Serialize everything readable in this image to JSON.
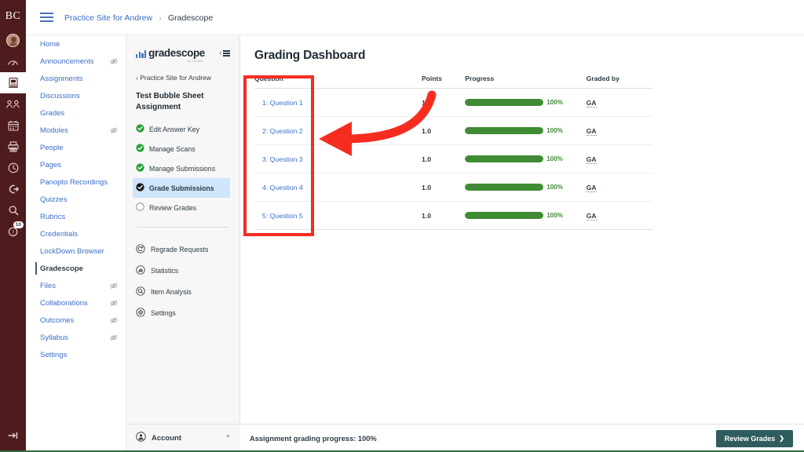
{
  "global_nav": {
    "logo_text": "BC",
    "items": [
      {
        "name": "account-avatar",
        "icon": "avatar-icon",
        "active": false
      },
      {
        "name": "dashboard",
        "icon": "dashboard-speedometer-icon",
        "active": false
      },
      {
        "name": "courses",
        "icon": "courses-book-icon",
        "active": true
      },
      {
        "name": "groups",
        "icon": "groups-people-icon",
        "active": false
      },
      {
        "name": "calendar",
        "icon": "calendar-icon",
        "active": false
      },
      {
        "name": "inbox",
        "icon": "inbox-printer-icon",
        "active": false
      },
      {
        "name": "history",
        "icon": "clock-history-icon",
        "active": false
      },
      {
        "name": "commons",
        "icon": "logout-arrow-icon",
        "active": false
      },
      {
        "name": "studio",
        "icon": "search-magnifier-icon",
        "active": false
      },
      {
        "name": "help",
        "icon": "help-question-icon",
        "active": false,
        "badge": "10"
      }
    ],
    "bottom_item": {
      "name": "expand-nav",
      "icon": "arrow-to-bar-icon"
    }
  },
  "header": {
    "menu_icon": "hamburger-menu-icon",
    "breadcrumb_course": "Practice Site for Andrew",
    "breadcrumb_separator": "›",
    "breadcrumb_current": "Gradescope"
  },
  "course_nav": {
    "items": [
      {
        "label": "Home",
        "hidden": false,
        "active": false
      },
      {
        "label": "Announcements",
        "hidden": true,
        "active": false
      },
      {
        "label": "Assignments",
        "hidden": false,
        "active": false
      },
      {
        "label": "Discussions",
        "hidden": false,
        "active": false
      },
      {
        "label": "Grades",
        "hidden": false,
        "active": false
      },
      {
        "label": "Modules",
        "hidden": true,
        "active": false
      },
      {
        "label": "People",
        "hidden": false,
        "active": false
      },
      {
        "label": "Pages",
        "hidden": false,
        "active": false
      },
      {
        "label": "Panopto Recordings",
        "hidden": false,
        "active": false
      },
      {
        "label": "Quizzes",
        "hidden": false,
        "active": false
      },
      {
        "label": "Rubrics",
        "hidden": false,
        "active": false
      },
      {
        "label": "Credentials",
        "hidden": false,
        "active": false
      },
      {
        "label": "LockDown Browser",
        "hidden": false,
        "active": false
      },
      {
        "label": "Gradescope",
        "hidden": false,
        "active": true
      },
      {
        "label": "Files",
        "hidden": true,
        "active": false
      },
      {
        "label": "Collaborations",
        "hidden": true,
        "active": false
      },
      {
        "label": "Outcomes",
        "hidden": true,
        "active": false
      },
      {
        "label": "Syllabus",
        "hidden": true,
        "active": false
      },
      {
        "label": "Settings",
        "hidden": false,
        "active": false
      }
    ]
  },
  "gradescope_panel": {
    "logo_wordmark": "gradescope",
    "logo_registered": "®",
    "logo_byline": "by Turnitin",
    "collapse_label": "collapse-sidebar",
    "back_link": "‹ Practice Site for Andrew",
    "assignment_title": "Test Bubble Sheet Assignment",
    "steps": [
      {
        "label": "Edit Answer Key",
        "state": "complete"
      },
      {
        "label": "Manage Scans",
        "state": "complete"
      },
      {
        "label": "Manage Submissions",
        "state": "complete"
      },
      {
        "label": "Grade Submissions",
        "state": "current"
      },
      {
        "label": "Review Grades",
        "state": "incomplete"
      }
    ],
    "tools": [
      {
        "label": "Regrade Requests",
        "icon": "regrade-refresh-icon"
      },
      {
        "label": "Statistics",
        "icon": "statistics-chart-icon"
      },
      {
        "label": "Item Analysis",
        "icon": "item-analysis-magnifier-icon"
      },
      {
        "label": "Settings",
        "icon": "settings-gear-icon"
      }
    ],
    "account_label": "Account",
    "account_icon": "account-person-icon",
    "account_chevron": "⌃"
  },
  "main": {
    "page_title": "Grading Dashboard",
    "table": {
      "columns": [
        "Question",
        "Points",
        "Progress",
        "Graded by"
      ],
      "rows": [
        {
          "question": "1: Question 1",
          "points": "1.0",
          "progress_pct": 100,
          "progress_label": "100%",
          "graded_by": "GA"
        },
        {
          "question": "2: Question 2",
          "points": "1.0",
          "progress_pct": 100,
          "progress_label": "100%",
          "graded_by": "GA"
        },
        {
          "question": "3: Question 3",
          "points": "1.0",
          "progress_pct": 100,
          "progress_label": "100%",
          "graded_by": "GA"
        },
        {
          "question": "4: Question 4",
          "points": "1.0",
          "progress_pct": 100,
          "progress_label": "100%",
          "graded_by": "GA"
        },
        {
          "question": "5: Question 5",
          "points": "1.0",
          "progress_pct": 100,
          "progress_label": "100%",
          "graded_by": "GA"
        }
      ]
    },
    "footer_text": "Assignment grading progress: 100%",
    "review_button_label": "Review Grades",
    "review_button_arrow": "❯"
  },
  "annotations": {
    "highlight_color": "#f62c21",
    "highlight_target": "Question column",
    "arrow_direction": "left",
    "arrow_color": "#f62c21"
  },
  "colors": {
    "global_nav_bg": "#4e1c1c",
    "link_blue": "#3b6ec4",
    "progress_green": "#3f8b34",
    "review_button_teal": "#2f5c5c",
    "current_step_bg": "#cfe5fb",
    "annotation_red": "#f62c21"
  }
}
